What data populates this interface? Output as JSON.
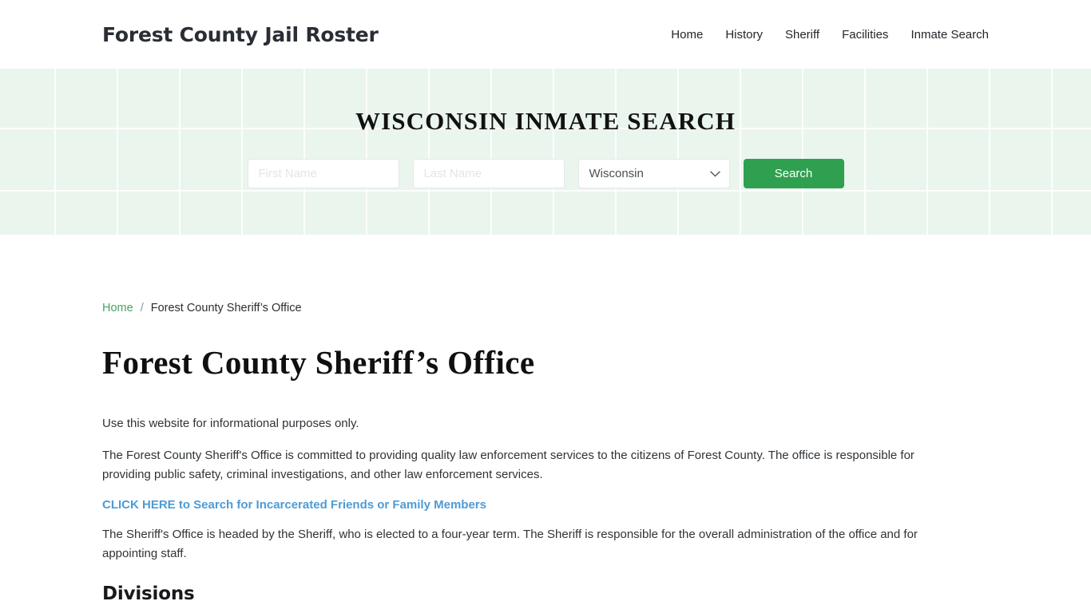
{
  "header": {
    "brand": "Forest County Jail Roster",
    "nav": [
      {
        "label": "Home"
      },
      {
        "label": "History"
      },
      {
        "label": "Sheriff"
      },
      {
        "label": "Facilities"
      },
      {
        "label": "Inmate Search"
      }
    ]
  },
  "hero": {
    "title": "WISCONSIN INMATE SEARCH",
    "background_color": "#eaf5ee",
    "form": {
      "first_name_placeholder": "First Name",
      "first_name_value": "",
      "last_name_placeholder": "Last Name",
      "last_name_value": "",
      "state_selected": "Wisconsin",
      "state_options": [
        "Wisconsin"
      ],
      "submit_label": "Search",
      "submit_color": "#2fa04f",
      "chevron_icon": "chevron-down-icon"
    }
  },
  "breadcrumb": {
    "home_label": "Home",
    "separator": "/",
    "current": "Forest County Sheriff’s Office",
    "link_color": "#43a463"
  },
  "main": {
    "page_title": "Forest County Sheriff’s Office",
    "paragraph_1": "Use this website for informational purposes only.",
    "paragraph_2": "The Forest County Sheriff's Office is committed to providing quality law enforcement services to the citizens of Forest County. The office is responsible for providing public safety, criminal investigations, and other law enforcement services.",
    "cta_link": "CLICK HERE to Search for Incarcerated Friends or Family Members",
    "cta_color": "#4e9bd6",
    "paragraph_3": "The Sheriff's Office is headed by the Sheriff, who is elected to a four-year term. The Sheriff is responsible for the overall administration of the office and for appointing staff.",
    "section_heading": "Divisions"
  }
}
